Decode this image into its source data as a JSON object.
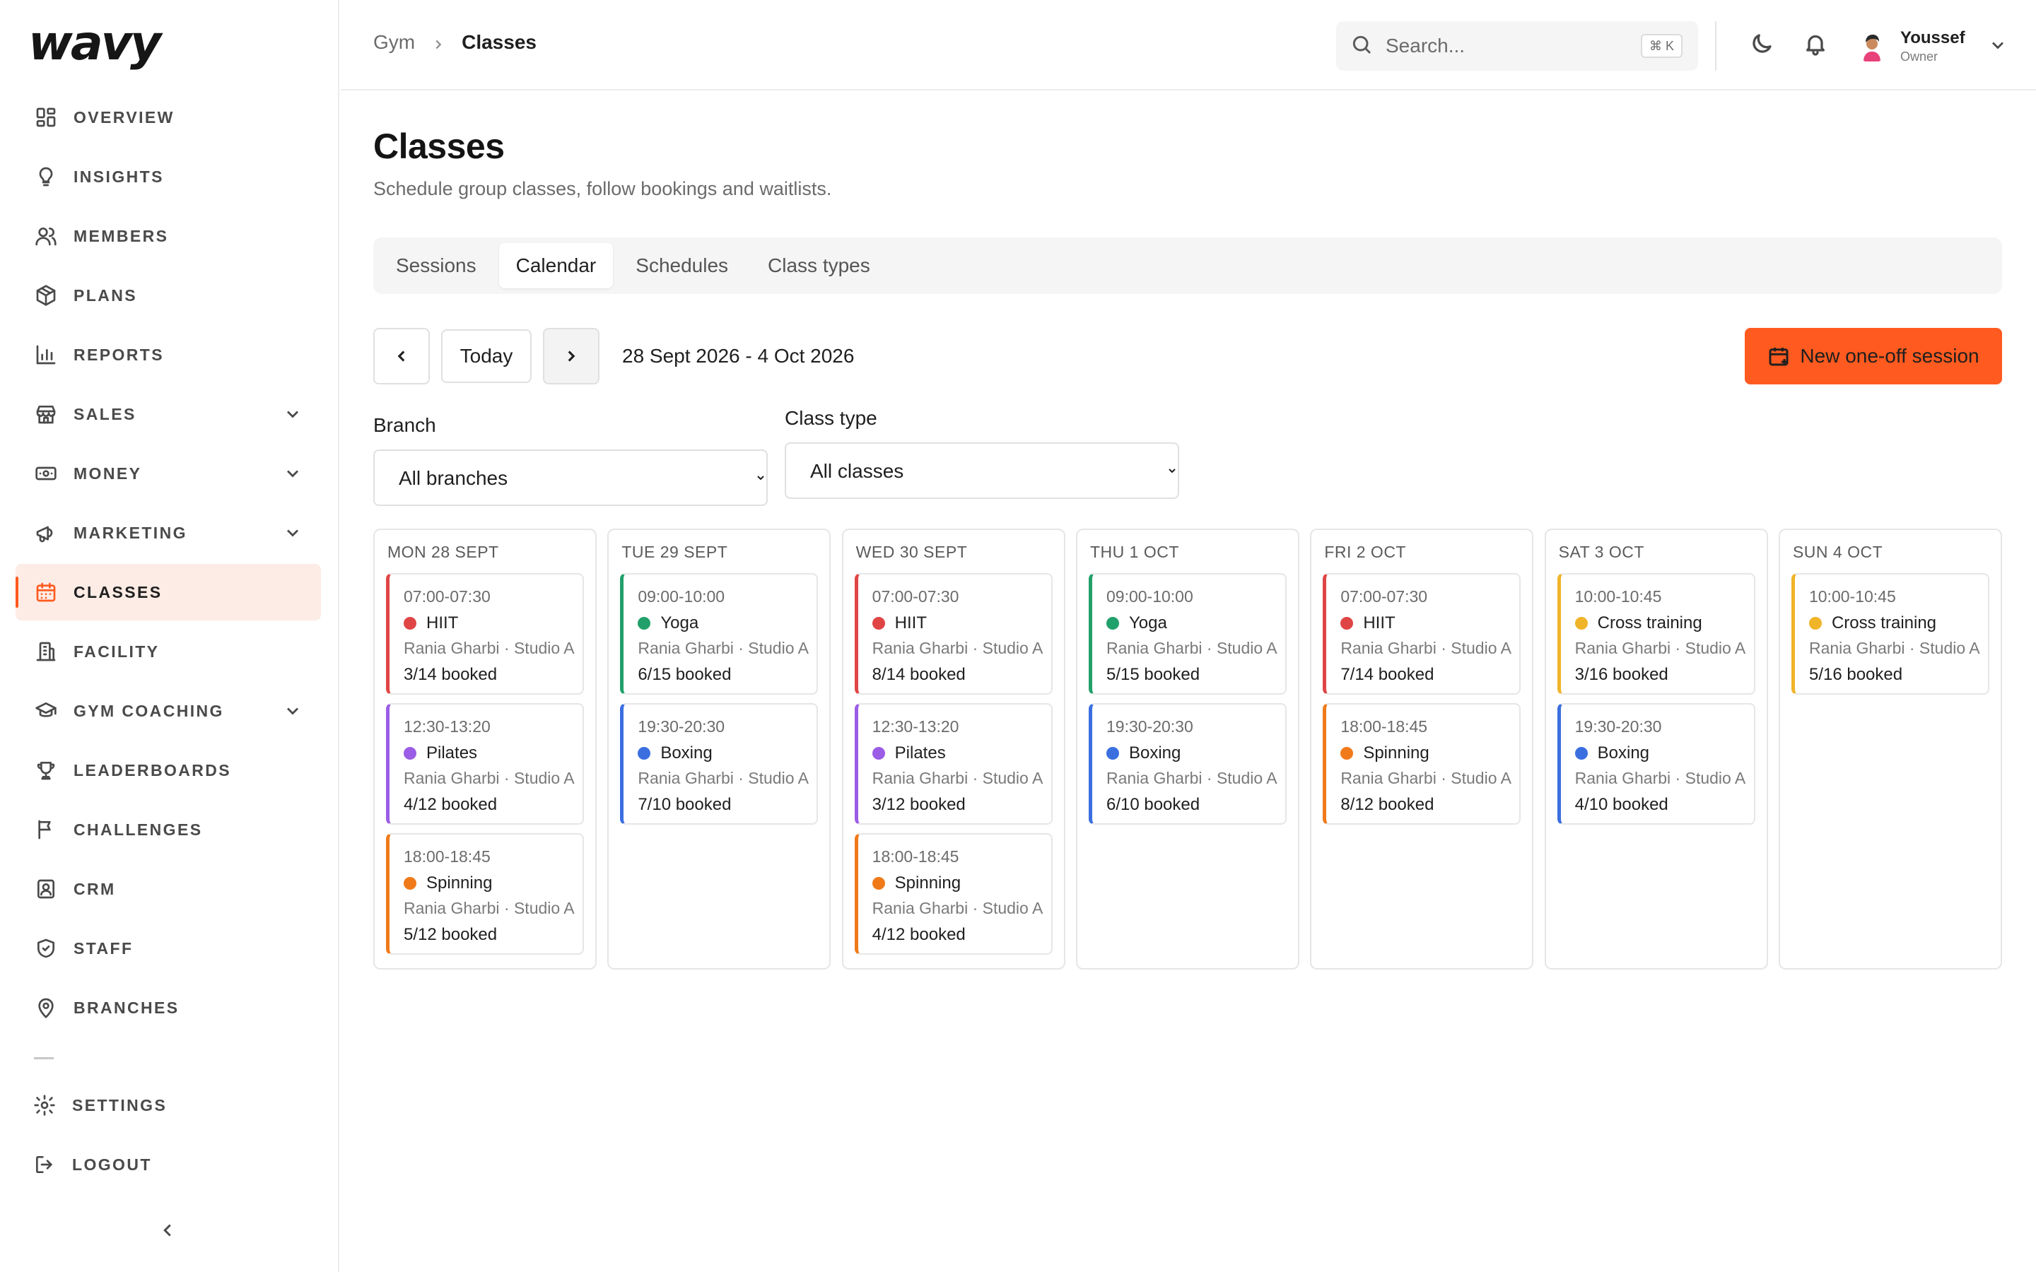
{
  "brand": {
    "logo": "wavy",
    "accent": "#ff5a1f"
  },
  "sidebar": {
    "items": [
      {
        "label": "OVERVIEW",
        "icon": "grid-icon",
        "expandable": false,
        "active": false
      },
      {
        "label": "INSIGHTS",
        "icon": "lightbulb-icon",
        "expandable": false,
        "active": false
      },
      {
        "label": "MEMBERS",
        "icon": "users-icon",
        "expandable": false,
        "active": false
      },
      {
        "label": "PLANS",
        "icon": "package-icon",
        "expandable": false,
        "active": false
      },
      {
        "label": "REPORTS",
        "icon": "bar-chart-icon",
        "expandable": false,
        "active": false
      },
      {
        "label": "SALES",
        "icon": "store-icon",
        "expandable": true,
        "active": false
      },
      {
        "label": "MONEY",
        "icon": "banknote-icon",
        "expandable": true,
        "active": false
      },
      {
        "label": "MARKETING",
        "icon": "megaphone-icon",
        "expandable": true,
        "active": false
      },
      {
        "label": "CLASSES",
        "icon": "calendar-icon",
        "expandable": false,
        "active": true
      },
      {
        "label": "FACILITY",
        "icon": "building-icon",
        "expandable": false,
        "active": false
      },
      {
        "label": "GYM COACHING",
        "icon": "graduation-cap-icon",
        "expandable": true,
        "active": false
      },
      {
        "label": "LEADERBOARDS",
        "icon": "trophy-icon",
        "expandable": false,
        "active": false
      },
      {
        "label": "CHALLENGES",
        "icon": "flag-icon",
        "expandable": false,
        "active": false
      },
      {
        "label": "CRM",
        "icon": "contact-icon",
        "expandable": false,
        "active": false
      },
      {
        "label": "STAFF",
        "icon": "shield-icon",
        "expandable": false,
        "active": false
      },
      {
        "label": "BRANCHES",
        "icon": "map-pin-icon",
        "expandable": false,
        "active": false
      }
    ],
    "bottom": [
      {
        "label": "SETTINGS",
        "icon": "gear-icon"
      },
      {
        "label": "LOGOUT",
        "icon": "logout-icon"
      }
    ]
  },
  "header": {
    "breadcrumb": {
      "root": "Gym",
      "current": "Classes"
    },
    "search": {
      "placeholder": "Search...",
      "shortcut": "⌘ K"
    },
    "user": {
      "name": "Youssef",
      "role": "Owner"
    }
  },
  "page": {
    "title": "Classes",
    "subtitle": "Schedule group classes, follow bookings and waitlists."
  },
  "tabs": [
    {
      "label": "Sessions",
      "active": false
    },
    {
      "label": "Calendar",
      "active": true
    },
    {
      "label": "Schedules",
      "active": false
    },
    {
      "label": "Class types",
      "active": false
    }
  ],
  "toolbar": {
    "today_label": "Today",
    "range": "28 Sept 2026 - 4 Oct 2026",
    "new_session_label": "New one-off session"
  },
  "filters": {
    "branch": {
      "label": "Branch",
      "value": "All branches"
    },
    "class_type": {
      "label": "Class type",
      "value": "All classes"
    }
  },
  "class_colors": {
    "HIIT": "#e04545",
    "Yoga": "#22a06b",
    "Pilates": "#9b5de5",
    "Boxing": "#3b6fe0",
    "Spinning": "#f07a1a",
    "Cross training": "#f0b429"
  },
  "days": [
    {
      "label": "MON 28 SEPT",
      "sessions": [
        {
          "time": "07:00-07:30",
          "type": "HIIT",
          "meta": "Rania Gharbi · Studio A",
          "booked": "3/14 booked"
        },
        {
          "time": "12:30-13:20",
          "type": "Pilates",
          "meta": "Rania Gharbi · Studio A",
          "booked": "4/12 booked"
        },
        {
          "time": "18:00-18:45",
          "type": "Spinning",
          "meta": "Rania Gharbi · Studio A",
          "booked": "5/12 booked"
        }
      ]
    },
    {
      "label": "TUE 29 SEPT",
      "sessions": [
        {
          "time": "09:00-10:00",
          "type": "Yoga",
          "meta": "Rania Gharbi · Studio A",
          "booked": "6/15 booked"
        },
        {
          "time": "19:30-20:30",
          "type": "Boxing",
          "meta": "Rania Gharbi · Studio A",
          "booked": "7/10 booked"
        }
      ]
    },
    {
      "label": "WED 30 SEPT",
      "sessions": [
        {
          "time": "07:00-07:30",
          "type": "HIIT",
          "meta": "Rania Gharbi · Studio A",
          "booked": "8/14 booked"
        },
        {
          "time": "12:30-13:20",
          "type": "Pilates",
          "meta": "Rania Gharbi · Studio A",
          "booked": "3/12 booked"
        },
        {
          "time": "18:00-18:45",
          "type": "Spinning",
          "meta": "Rania Gharbi · Studio A",
          "booked": "4/12 booked"
        }
      ]
    },
    {
      "label": "THU 1 OCT",
      "sessions": [
        {
          "time": "09:00-10:00",
          "type": "Yoga",
          "meta": "Rania Gharbi · Studio A",
          "booked": "5/15 booked"
        },
        {
          "time": "19:30-20:30",
          "type": "Boxing",
          "meta": "Rania Gharbi · Studio A",
          "booked": "6/10 booked"
        }
      ]
    },
    {
      "label": "FRI 2 OCT",
      "sessions": [
        {
          "time": "07:00-07:30",
          "type": "HIIT",
          "meta": "Rania Gharbi · Studio A",
          "booked": "7/14 booked"
        },
        {
          "time": "18:00-18:45",
          "type": "Spinning",
          "meta": "Rania Gharbi · Studio A",
          "booked": "8/12 booked"
        }
      ]
    },
    {
      "label": "SAT 3 OCT",
      "sessions": [
        {
          "time": "10:00-10:45",
          "type": "Cross training",
          "meta": "Rania Gharbi · Studio A",
          "booked": "3/16 booked"
        },
        {
          "time": "19:30-20:30",
          "type": "Boxing",
          "meta": "Rania Gharbi · Studio A",
          "booked": "4/10 booked"
        }
      ]
    },
    {
      "label": "SUN 4 OCT",
      "sessions": [
        {
          "time": "10:00-10:45",
          "type": "Cross training",
          "meta": "Rania Gharbi · Studio A",
          "booked": "5/16 booked"
        }
      ]
    }
  ]
}
